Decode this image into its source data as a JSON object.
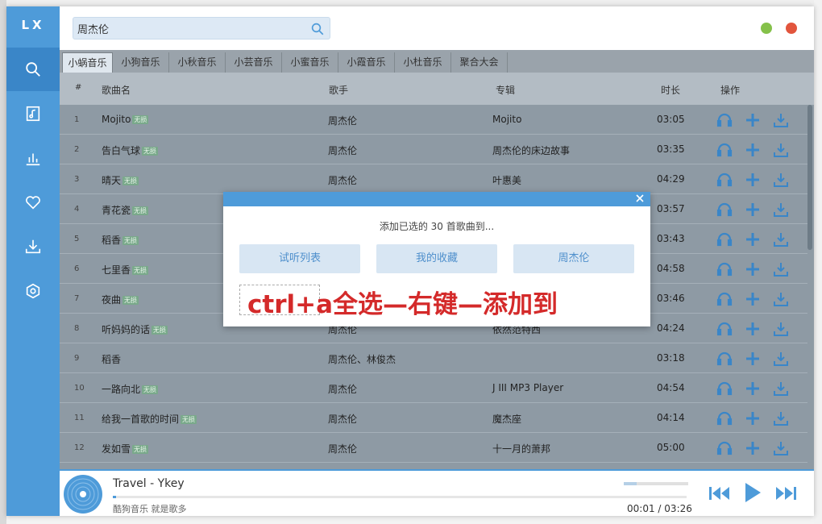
{
  "app": {
    "logo": "LX"
  },
  "search": {
    "value": "周杰伦",
    "placeholder": ""
  },
  "sidebar": {
    "items": [
      {
        "icon": "search-icon",
        "active": true
      },
      {
        "icon": "playlist-icon"
      },
      {
        "icon": "chart-icon"
      },
      {
        "icon": "heart-icon"
      },
      {
        "icon": "download-icon"
      },
      {
        "icon": "settings-icon"
      }
    ]
  },
  "tabs": [
    "小蜗音乐",
    "小狗音乐",
    "小秋音乐",
    "小芸音乐",
    "小蜜音乐",
    "小霞音乐",
    "小杜音乐",
    "聚合大会"
  ],
  "table": {
    "headers": {
      "index": "#",
      "name": "歌曲名",
      "artist": "歌手",
      "album": "专辑",
      "duration": "时长",
      "ops": "操作"
    },
    "badge": "无损",
    "rows": [
      {
        "index": "1",
        "name": "Mojito",
        "badge": true,
        "artist": "周杰伦",
        "album": "Mojito",
        "duration": "03:05"
      },
      {
        "index": "2",
        "name": "告白气球",
        "badge": true,
        "artist": "周杰伦",
        "album": "周杰伦的床边故事",
        "duration": "03:35"
      },
      {
        "index": "3",
        "name": "晴天",
        "badge": true,
        "artist": "周杰伦",
        "album": "叶惠美",
        "duration": "04:29"
      },
      {
        "index": "4",
        "name": "青花瓷",
        "badge": true,
        "artist": "",
        "album": "",
        "duration": "03:57"
      },
      {
        "index": "5",
        "name": "稻香",
        "badge": true,
        "artist": "",
        "album": "",
        "duration": "03:43"
      },
      {
        "index": "6",
        "name": "七里香",
        "badge": true,
        "artist": "",
        "album": "",
        "duration": "04:58"
      },
      {
        "index": "7",
        "name": "夜曲",
        "badge": true,
        "artist": "",
        "album": "",
        "duration": "03:46"
      },
      {
        "index": "8",
        "name": "听妈妈的话",
        "badge": true,
        "artist": "周杰伦",
        "album": "依然范特西",
        "duration": "04:24"
      },
      {
        "index": "9",
        "name": "稻香",
        "badge": false,
        "artist": "周杰伦、林俊杰",
        "album": "",
        "duration": "03:18"
      },
      {
        "index": "10",
        "name": "一路向北",
        "badge": true,
        "artist": "周杰伦",
        "album": "J III MP3 Player",
        "duration": "04:54"
      },
      {
        "index": "11",
        "name": "给我一首歌的时间",
        "badge": true,
        "artist": "周杰伦",
        "album": "魔杰座",
        "duration": "04:14"
      },
      {
        "index": "12",
        "name": "发如雪",
        "badge": true,
        "artist": "周杰伦",
        "album": "十一月的萧邦",
        "duration": "05:00"
      }
    ]
  },
  "modal": {
    "message": "添加已选的 30 首歌曲到...",
    "buttons": [
      "试听列表",
      "我的收藏",
      "周杰伦"
    ],
    "close": "×",
    "annotation": "ctrl+a全选—右键—添加到"
  },
  "player": {
    "title": "Travel - Ykey",
    "subtitle": "酷狗音乐 就是歌多",
    "current_time": "00:01",
    "separator": "/",
    "total_time": "03:26",
    "progress": 0.005,
    "volume": 0.2
  },
  "colors": {
    "accent": "#4e9bd9",
    "close": "#e2553d",
    "minimize": "#85c14a",
    "annotation": "#d42a2a"
  }
}
